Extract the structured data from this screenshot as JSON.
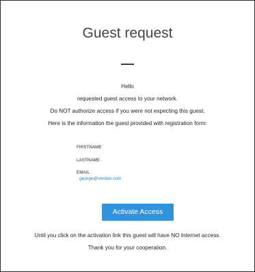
{
  "email": {
    "title": "Guest request",
    "greeting": "Hello",
    "line1": "requested guest access to your network.",
    "line2": "Do NOT authorize access if you were not expecting this guest.",
    "line3": "Here is the information the guest provided with registration form:",
    "fields": [
      {
        "label": "FIRSTNAME",
        "value": ""
      },
      {
        "label": "LASTNAME",
        "value": ""
      },
      {
        "label": "EMAIL",
        "value": "george@vendor.com"
      }
    ],
    "button_label": "Activate Access",
    "footer_line1": "Until you click on the activation link this guest will have NO Internet access.",
    "footer_line2": "Thank you for your cooperation."
  },
  "colors": {
    "accent": "#2f93e0",
    "link": "#1e7fd6",
    "border": "#2a2a2a"
  }
}
